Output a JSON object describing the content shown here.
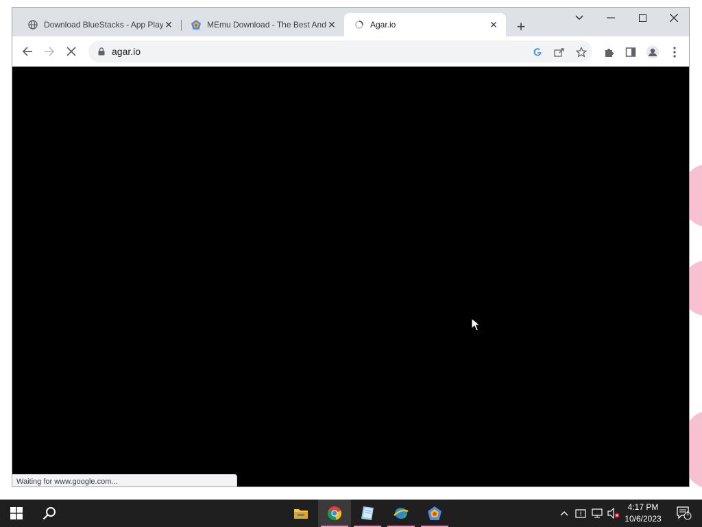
{
  "browser": {
    "tabs": [
      {
        "title": "Download BlueStacks - App Play",
        "favicon": "globe-icon",
        "active": false
      },
      {
        "title": "MEmu Download - The Best And",
        "favicon": "memu-icon",
        "active": false
      },
      {
        "title": "Agar.io",
        "favicon": "loading-icon",
        "active": true
      }
    ],
    "address": "agar.io",
    "status_text": "Waiting for www.google.com...",
    "content_color": "#000000"
  },
  "taskbar": {
    "clock_time": "4:17 PM",
    "clock_date": "10/6/2023",
    "apps": [
      "file-explorer-icon",
      "chrome-icon",
      "notepad-icon",
      "ie-download-icon",
      "memu-app-icon"
    ],
    "notification_count": "1",
    "accent_color": "#e39ab7"
  }
}
